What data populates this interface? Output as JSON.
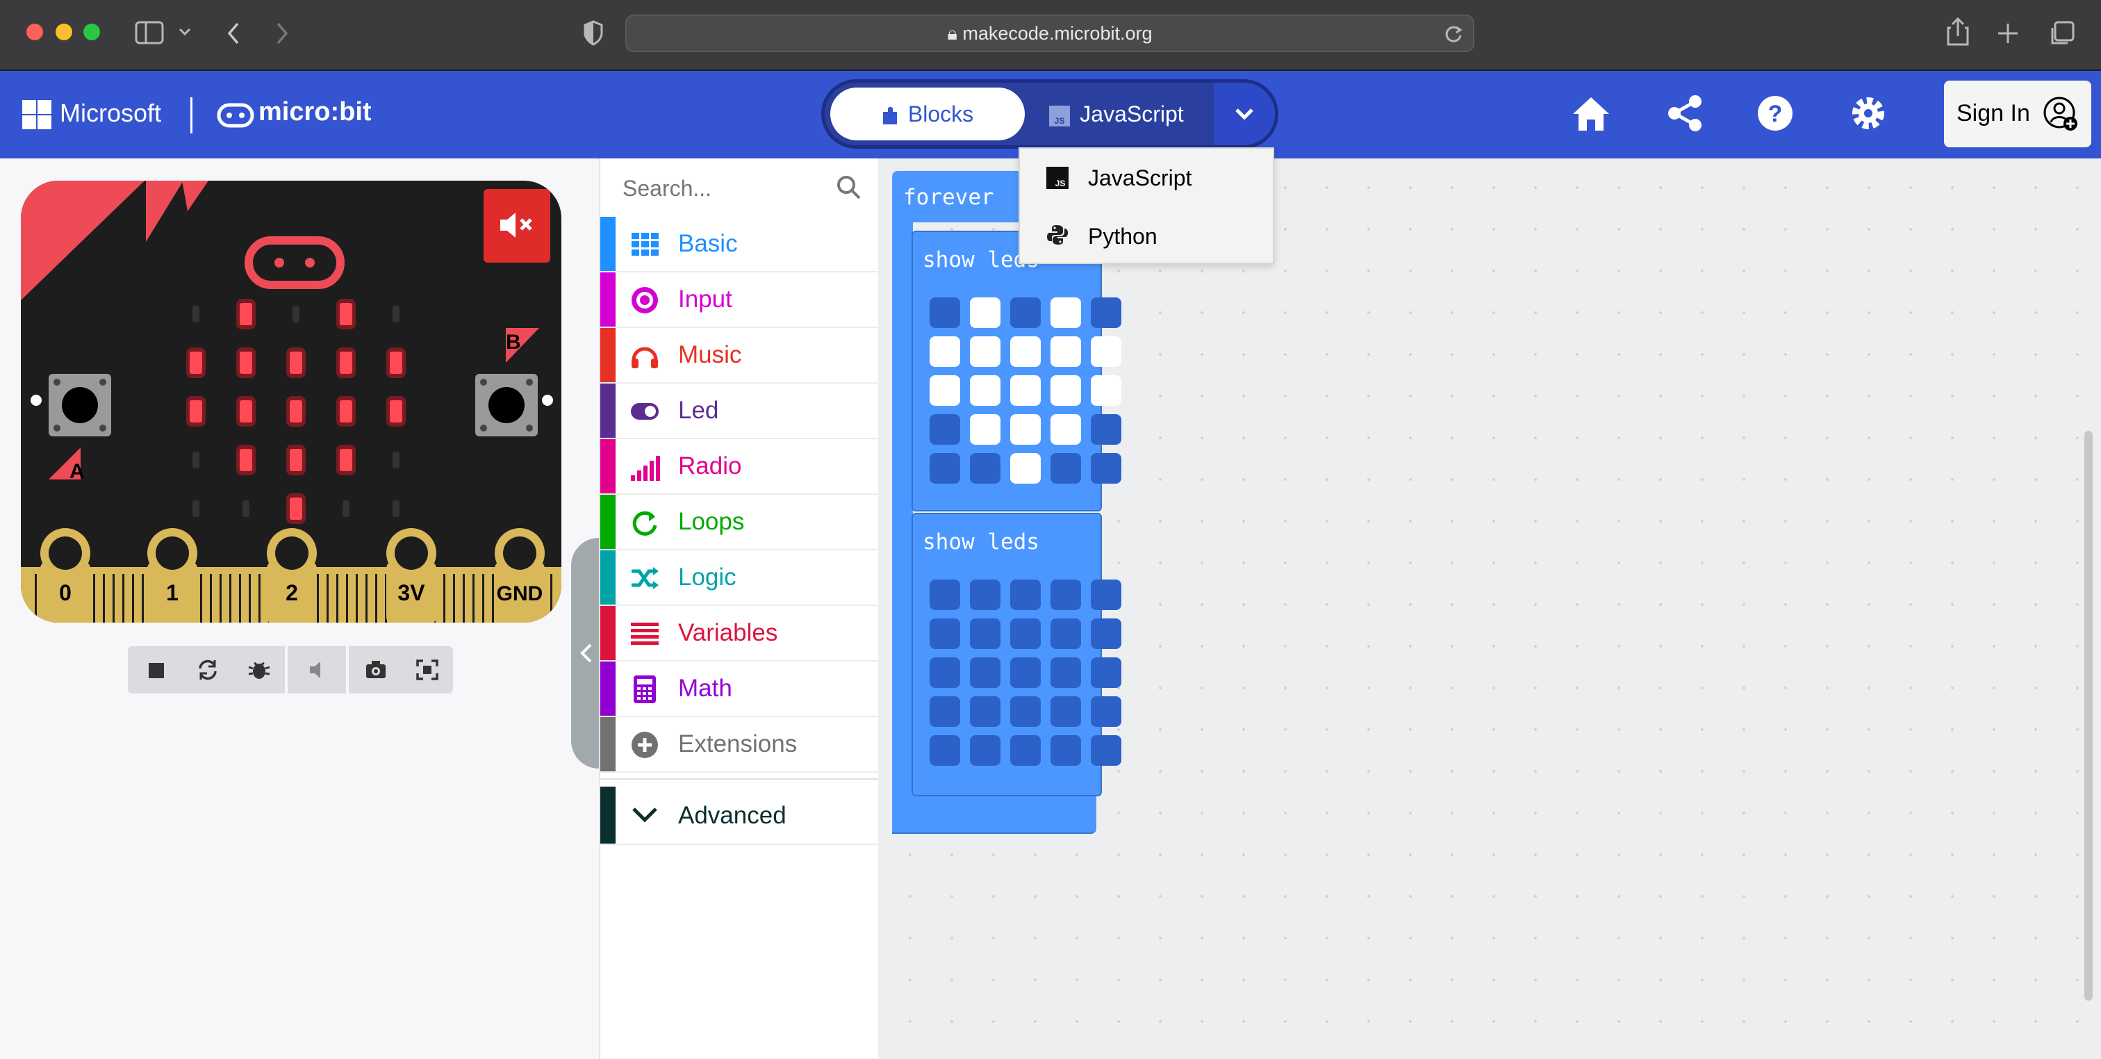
{
  "browser": {
    "url": "makecode.microbit.org"
  },
  "header": {
    "microsoft_label": "Microsoft",
    "microbit_label": "micro:bit",
    "editor_tabs": {
      "blocks": "Blocks",
      "javascript": "JavaScript"
    },
    "sign_in": "Sign In"
  },
  "dropdown": {
    "items": [
      {
        "label": "JavaScript",
        "icon": "js-icon"
      },
      {
        "label": "Python",
        "icon": "python-icon"
      }
    ]
  },
  "simulator": {
    "pins": [
      "0",
      "1",
      "2",
      "3V",
      "GND"
    ],
    "button_a": "A",
    "button_b": "B"
  },
  "toolbox": {
    "search_placeholder": "Search...",
    "categories": [
      {
        "label": "Basic",
        "color": "#1e90ff"
      },
      {
        "label": "Input",
        "color": "#d400d4"
      },
      {
        "label": "Music",
        "color": "#e63022"
      },
      {
        "label": "Led",
        "color": "#5c2d91"
      },
      {
        "label": "Radio",
        "color": "#e3008c"
      },
      {
        "label": "Loops",
        "color": "#00aa00"
      },
      {
        "label": "Logic",
        "color": "#00a4a6"
      },
      {
        "label": "Variables",
        "color": "#dc143c"
      },
      {
        "label": "Math",
        "color": "#9400d3"
      },
      {
        "label": "Extensions",
        "color": "#717171"
      }
    ],
    "advanced": "Advanced"
  },
  "workspace": {
    "forever_label": "forever",
    "show_leds_label": "show leds",
    "show_leds_1": [
      [
        0,
        1,
        0,
        1,
        0
      ],
      [
        1,
        1,
        1,
        1,
        1
      ],
      [
        1,
        1,
        1,
        1,
        1
      ],
      [
        0,
        1,
        1,
        1,
        0
      ],
      [
        0,
        0,
        1,
        0,
        0
      ]
    ],
    "show_leds_2": [
      [
        0,
        0,
        0,
        0,
        0
      ],
      [
        0,
        0,
        0,
        0,
        0
      ],
      [
        0,
        0,
        0,
        0,
        0
      ],
      [
        0,
        0,
        0,
        0,
        0
      ],
      [
        0,
        0,
        0,
        0,
        0
      ]
    ]
  },
  "colors": {
    "header": "#3454d1",
    "block": "#4c97ff",
    "board_red": "#ee4b57",
    "pin_gold": "#d9b85a"
  }
}
